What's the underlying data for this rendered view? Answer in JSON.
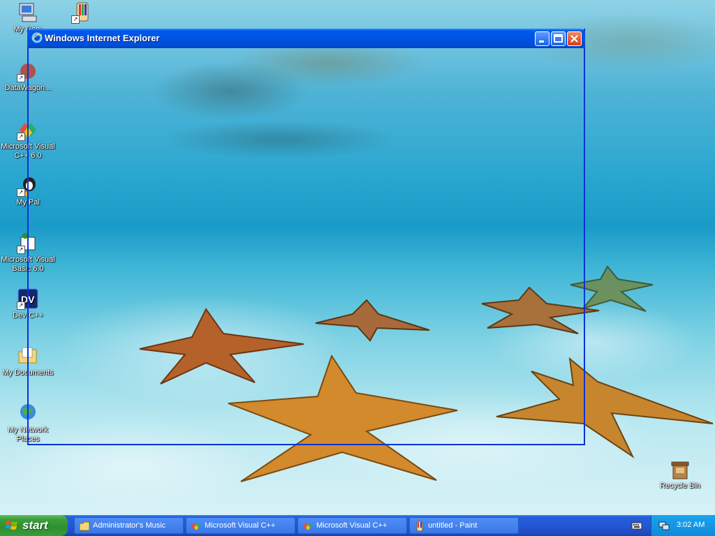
{
  "desktop": {
    "icons": [
      {
        "label": "My Computer",
        "display": "My Com"
      },
      {
        "label": "DataWagon...",
        "display": "DataWagon..."
      },
      {
        "label": "Microsoft Visual C++ 6.0",
        "display": "Microsoft Visual C++ 6.0"
      },
      {
        "label": "My Pal",
        "display": "My Pal"
      },
      {
        "label": "Microsoft Visual Basic 6.0",
        "display": "Microsoft Visual Basic 6.0"
      },
      {
        "label": "Dev-C++",
        "display": "Dev-C++"
      },
      {
        "label": "My Documents",
        "display": "My Documents"
      },
      {
        "label": "My Network Places",
        "display": "My Network Places"
      },
      {
        "label": "Recycle Bin",
        "display": "Recycle Bin"
      }
    ]
  },
  "ie_window": {
    "title": "Windows Internet Explorer",
    "minimize_icon": "minimize-icon",
    "maximize_icon": "maximize-icon",
    "close_icon": "close-icon"
  },
  "taskbar": {
    "start_label": "start",
    "tasks": [
      {
        "label": "Administrator's Music",
        "icon": "folder-icon"
      },
      {
        "label": "Microsoft Visual C++",
        "icon": "visual-cpp-icon"
      },
      {
        "label": "Microsoft Visual C++",
        "icon": "visual-cpp-icon"
      },
      {
        "label": "untitled - Paint",
        "icon": "paint-icon"
      }
    ],
    "clock": "3:02 AM"
  }
}
